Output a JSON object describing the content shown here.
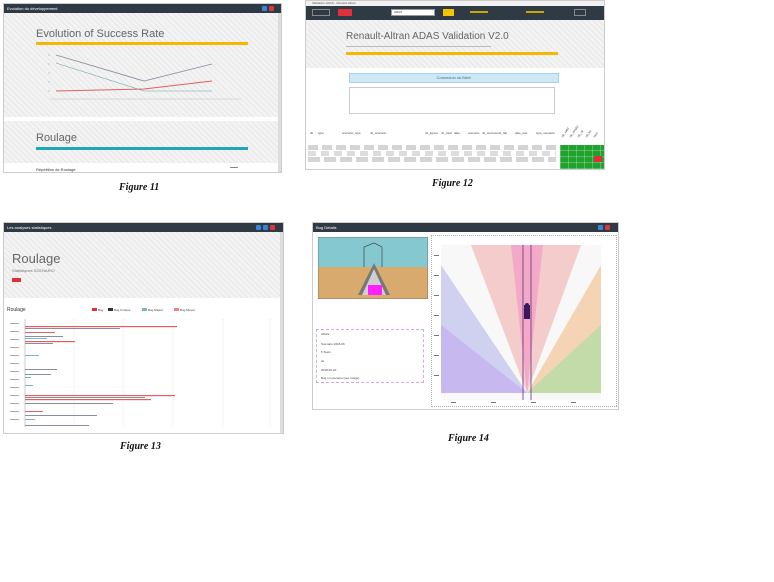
{
  "fig11": {
    "caption": "Figure 11",
    "window_title": "Evolution du développement",
    "chart_title": "Evolution of Success Rate",
    "section_title": "Roulage",
    "footer_left": "Répétition de Roulage",
    "accent_color": "#f5b800",
    "teal_color": "#1fa7b8"
  },
  "fig12": {
    "caption": "Figure 12",
    "window_title": "Validation ADAS - Renault-Altran",
    "select_value": "ADAS",
    "app_title": "Renault-Altran ADAS Validation V2.0",
    "info_banner": "Connexion ok Bien!",
    "table_headers": [
      "ID",
      "type",
      "scenario_type",
      "nb_scenario",
      "nb_lignes",
      "nb_total",
      "date",
      "scenario",
      "nb_success",
      "nb_fail",
      "date_test",
      "type_scenario"
    ],
    "rotated_headers": [
      "nb_valid",
      "nb_invalid",
      "nb_ok",
      "nb_ko",
      "taux"
    ]
  },
  "fig13": {
    "caption": "Figure 13",
    "window_title": "Les analyses statistiques",
    "heading": "Roulage",
    "subheading": "Statistiques SCENARIO",
    "chart_label": "Roulage",
    "legend": [
      "Bug",
      "Bug Critique",
      "Bug Majeur",
      "Bug Mineur"
    ]
  },
  "fig14": {
    "caption": "Figure 14",
    "window_title": "Bug Details",
    "info_lines": [
      "ADAS",
      "Scenario 2018-06",
      "5 Tests",
      "ok",
      "2018-06-20",
      "Bug on scenario (see image)"
    ]
  }
}
